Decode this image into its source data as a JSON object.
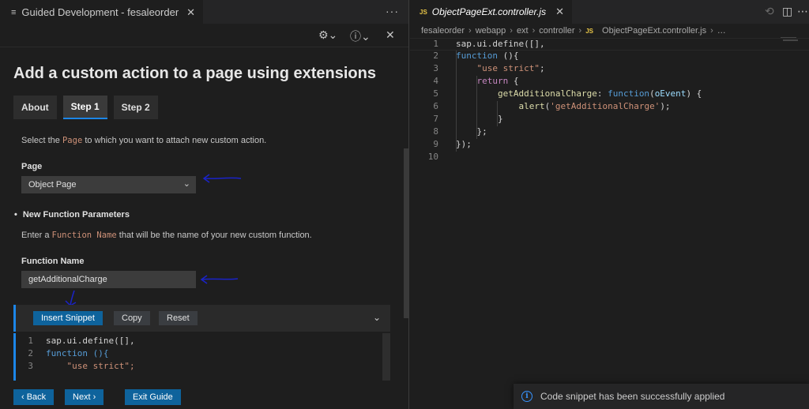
{
  "left_tab": {
    "icon": "menu-lines-icon",
    "title": "Guided Development - fesaleorder",
    "close": "✕",
    "more": "···"
  },
  "toolbar": {
    "settings_icon": "⚙⌄",
    "info_icon": "ⓘ⌄",
    "close_icon": "✕"
  },
  "guide": {
    "title": "Add a custom action to a page using extensions",
    "steps": [
      {
        "label": "About"
      },
      {
        "label": "Step 1",
        "active": true
      },
      {
        "label": "Step 2"
      }
    ],
    "page_instruction": {
      "before": "Select the ",
      "code": "Page",
      "after": " to which you want to attach new custom action."
    },
    "page_label": "Page",
    "page_value": "Object Page",
    "section_heading": "New Function Parameters",
    "function_instruction": {
      "before": "Enter a ",
      "code": "Function Name",
      "after": " that will be the name of your new custom function."
    },
    "function_label": "Function Name",
    "function_value": "getAdditionalCharge",
    "snippet_buttons": {
      "insert": "Insert Snippet",
      "copy": "Copy",
      "reset": "Reset"
    },
    "snippet_lines": [
      {
        "n": "1",
        "t": "sap.ui.define([],"
      },
      {
        "n": "2",
        "t": "function (){"
      },
      {
        "n": "3",
        "t": "    \"use strict\";"
      }
    ],
    "nav": {
      "back": "‹ Back",
      "next": "Next ›",
      "exit": "Exit Guide"
    }
  },
  "editor": {
    "tab_badge": "JS",
    "tab_title": "ObjectPageExt.controller.js",
    "tab_close": "✕",
    "breadcrumb": [
      "fesaleorder",
      "webapp",
      "ext",
      "controller"
    ],
    "breadcrumb_file": "ObjectPageExt.controller.js",
    "breadcrumb_tail": "…",
    "line_numbers": [
      "1",
      "2",
      "3",
      "4",
      "5",
      "6",
      "7",
      "8",
      "9",
      "10"
    ]
  },
  "toast": {
    "text": "Code snippet has been successfully applied"
  },
  "colors": {
    "accent": "#0e639c",
    "focus": "#1c86e8",
    "annotation": "#1a23c9"
  }
}
